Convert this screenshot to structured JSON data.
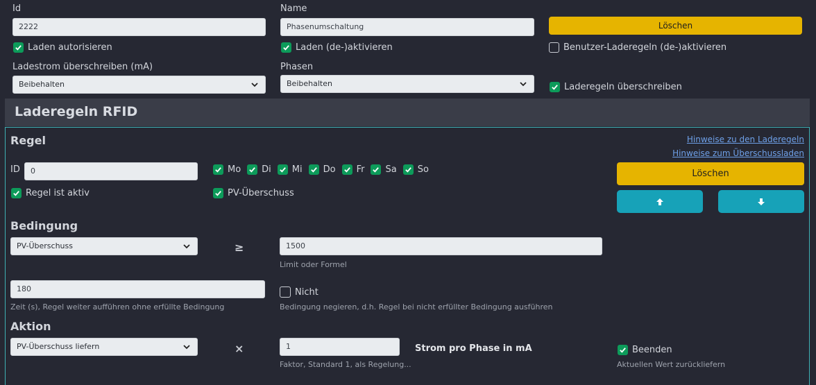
{
  "top": {
    "id_label": "Id",
    "id_value": "2222",
    "name_label": "Name",
    "name_value": "Phasenumschaltung",
    "delete_label": "Löschen",
    "auth_label": "Laden autorisieren",
    "activate_label": "Laden (de-)aktivieren",
    "user_rules_label": "Benutzer-Laderegeln (de-)aktivieren",
    "current_label": "Ladestrom überschreiben (mA)",
    "current_value": "Beibehalten",
    "phases_label": "Phasen",
    "phases_value": "Beibehalten",
    "override_label": "Laderegeln überschreiben"
  },
  "section": {
    "title": "Laderegeln RFID"
  },
  "rule": {
    "title": "Regel",
    "hint_link_1": "Hinweise zu den Laderegeln",
    "hint_link_2": "Hinweise zum Überschussladen",
    "id_label": "ID",
    "id_value": "0",
    "days": [
      "Mo",
      "Di",
      "Mi",
      "Do",
      "Fr",
      "Sa",
      "So"
    ],
    "active_label": "Regel ist aktiv",
    "pv_label": "PV-Überschuss",
    "delete_label": "Löschen"
  },
  "condition": {
    "title": "Bedingung",
    "select_value": "PV-Überschuss",
    "operator": "≥",
    "limit_value": "1500",
    "limit_hint": "Limit oder Formel",
    "time_value": "180",
    "time_hint": "Zeit (s), Regel weiter aufführen ohne erfüllte Bedingung",
    "not_label": "Nicht",
    "not_hint": "Bedingung negieren, d.h. Regel bei nicht erfüllter Bedingung ausführen"
  },
  "action": {
    "title": "Aktion",
    "select_value": "PV-Überschuss liefern",
    "operator": "×",
    "factor_value": "1",
    "factor_hint": "Faktor, Standard 1, als Regelung...",
    "unit_label": "Strom pro Phase in mA",
    "end_label": "Beenden",
    "end_hint": "Aktuellen Wert zurückliefern"
  },
  "colors": {
    "background": "#262833",
    "accent_yellow": "#e6b400",
    "accent_teal": "#17a2b8",
    "checkbox_green": "#0d9b5a"
  }
}
